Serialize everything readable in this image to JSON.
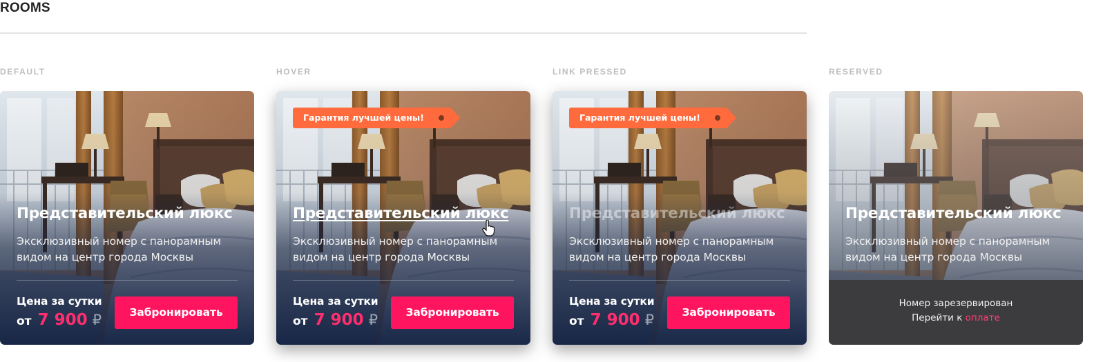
{
  "section": {
    "title": "ROOMS"
  },
  "states": [
    {
      "label": "DEFAULT"
    },
    {
      "label": "HOVER"
    },
    {
      "label": "LINK PRESSED"
    },
    {
      "label": "RESERVED"
    }
  ],
  "badge": {
    "text": "Гарантия лучшей цены!"
  },
  "room": {
    "title": "Представительский люкс",
    "description": "Эксклюзивный номер с панорамным видом на центр города Москвы",
    "price_label": "Цена за сутки",
    "price_from": "от",
    "price_value": "7 900",
    "currency": "₽",
    "book_label": "Забронировать"
  },
  "reserved": {
    "line1": "Номер зарезервирован",
    "line2_prefix": "Перейти к",
    "pay_link": "оплате"
  },
  "colors": {
    "accent": "#ff1460",
    "price": "#ff2e6e",
    "badge": "#ff6b3d",
    "reserved_panel": "#3c3c3f"
  },
  "icons": [
    "hotel-room-photo",
    "price-tag-badge",
    "hand-pointer-cursor-icon"
  ]
}
